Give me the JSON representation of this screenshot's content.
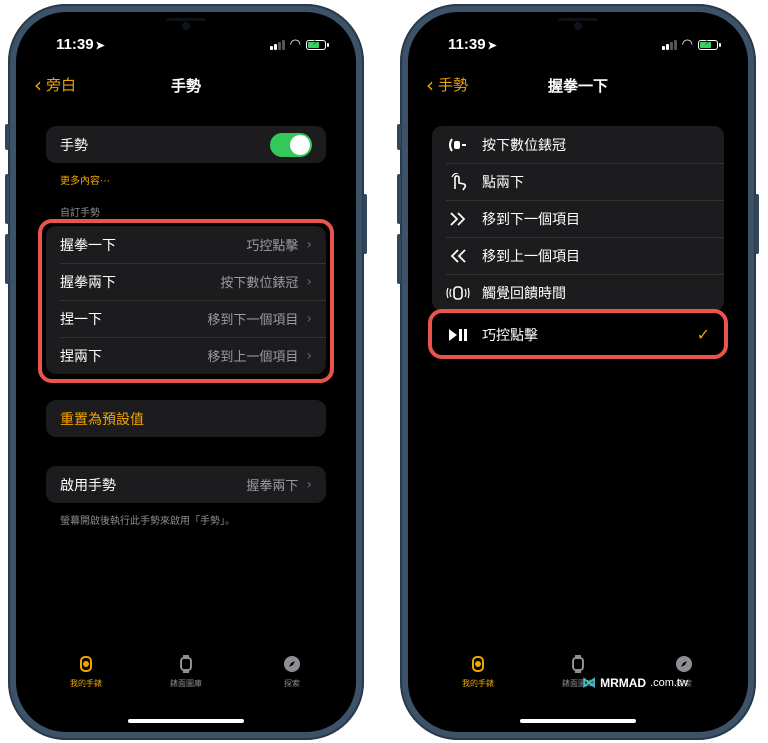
{
  "status": {
    "time": "11:39"
  },
  "left": {
    "back_label": "旁白",
    "title": "手勢",
    "toggle_label": "手勢",
    "more_link": "更多內容⋯",
    "section_header": "自訂手勢",
    "gestures": [
      {
        "label": "握拳一下",
        "value": "巧控點擊"
      },
      {
        "label": "握拳兩下",
        "value": "按下數位錶冠"
      },
      {
        "label": "捏一下",
        "value": "移到下一個項目"
      },
      {
        "label": "捏兩下",
        "value": "移到上一個項目"
      }
    ],
    "reset_label": "重置為預設值",
    "enable_label": "啟用手勢",
    "enable_value": "握拳兩下",
    "footnote": "螢幕開啟後執行此手勢來啟用「手勢」。"
  },
  "right": {
    "back_label": "手勢",
    "title": "握拳一下",
    "options": [
      {
        "label": "按下數位錶冠",
        "icon": "digital-crown-icon"
      },
      {
        "label": "點兩下",
        "icon": "tap-hand-icon"
      },
      {
        "label": "移到下一個項目",
        "icon": "double-chevron-right-icon"
      },
      {
        "label": "移到上一個項目",
        "icon": "double-chevron-left-icon"
      },
      {
        "label": "觸覺回饋時間",
        "icon": "haptic-watch-icon"
      },
      {
        "label": "巧控點擊",
        "icon": "play-pause-icon",
        "selected": true
      }
    ]
  },
  "tabs": [
    {
      "label": "我的手錶",
      "icon": "my-watch-icon",
      "active": true
    },
    {
      "label": "錶面圖庫",
      "icon": "face-gallery-icon"
    },
    {
      "label": "探索",
      "icon": "discover-compass-icon"
    }
  ],
  "watermark": {
    "brand": "MRMAD",
    "domain": ".com.tw"
  },
  "colors": {
    "accent": "#f0a400",
    "toggle_on": "#34c759",
    "highlight": "#e8554d"
  }
}
